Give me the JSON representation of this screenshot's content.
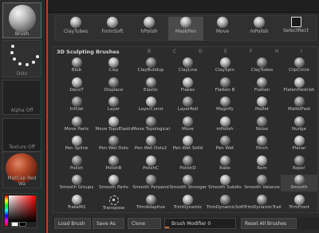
{
  "tray": {
    "brush_label": "Brush",
    "stroke_label": "Dots",
    "alpha_label": "Alpha Off",
    "texture_label": "Texture Off",
    "material_label": "MatCap Red Wa"
  },
  "quick_row": [
    {
      "label": "ClayTubes",
      "icon": "brush-sphere-icon"
    },
    {
      "label": "FormSoft",
      "icon": "brush-sphere-icon"
    },
    {
      "label": "hPolish",
      "icon": "brush-sphere-icon"
    },
    {
      "label": "MaskPen",
      "icon": "brush-sphere-icon"
    },
    {
      "label": "Move",
      "icon": "brush-sphere-icon"
    },
    {
      "label": "mPolish",
      "icon": "brush-sphere-icon"
    },
    {
      "label": "SelectRect",
      "icon": "select-rect-icon"
    }
  ],
  "panel": {
    "title": "3D Sculpting Brushes",
    "letters": [
      "B",
      "C",
      "D",
      "E",
      "F",
      "H",
      "I"
    ]
  },
  "brushes": [
    [
      "Blob",
      "Clay",
      "ClayBuildup",
      "ClayLine",
      "ClaySpin",
      "ClayTubes",
      "ClipCircle"
    ],
    [
      "DecoT",
      "Displace",
      "Elastic",
      "Flakes",
      "Flatten B",
      "Flatten",
      "FlatenHeshish"
    ],
    [
      "InfUat",
      "Layer",
      "LayerConst",
      "LayerRoll",
      "Magnify",
      "MaIIet",
      "MaIIetFast"
    ],
    [
      "Move Parts",
      "Move TopoElastic",
      "Move Topological",
      "Move",
      "mPolish",
      "Noise",
      "Nudge"
    ],
    [
      "Pen Spline",
      "Pen Wet Dots",
      "Pen Wet Dots2",
      "Pen Wet Solid",
      "Pen Wet",
      "Pinch",
      "Planar"
    ],
    [
      "Polish",
      "PolishB",
      "PolishC",
      "PolishD",
      "Rake",
      "Rem",
      "Rope!"
    ],
    [
      "Smooth Groups",
      "Smooth Parts",
      "Smooth Perpend",
      "Smooth Stronger",
      "Smooth Subdiv",
      "Smooth Valance",
      "Smooth"
    ],
    [
      "TrakeM2",
      "Transpose",
      "TrimAdaptive",
      "TrimDynamic",
      "TrimDynamicSoft",
      "TrimDynamicTrail",
      "TrimFront"
    ]
  ],
  "bottom": {
    "load_label": "Load Brush",
    "save_label": "Save As",
    "clone_label": "Clone",
    "modifier_label": "Brush Modifier",
    "modifier_value": "0",
    "reset_label": "Reset All Brushes"
  },
  "colors": {
    "accent": "#c83c22",
    "slider_fill": "#d86a2a"
  }
}
